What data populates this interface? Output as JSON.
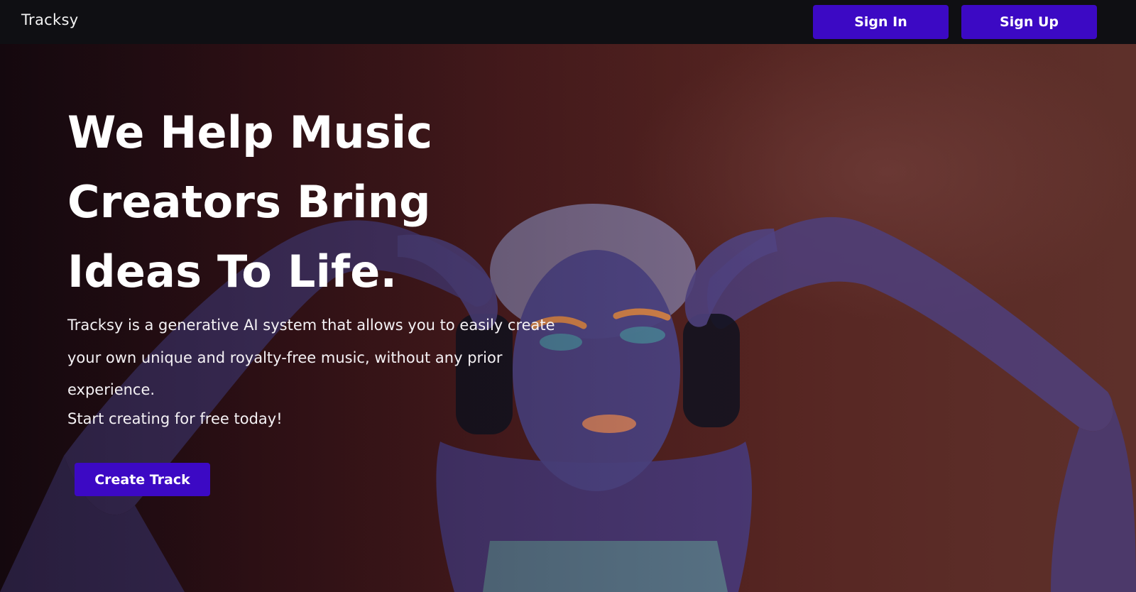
{
  "header": {
    "brand": "Tracksy",
    "sign_in_label": "Sign In",
    "sign_up_label": "Sign Up"
  },
  "hero": {
    "title": "We Help Music Creators Bring Ideas To Life.",
    "description": "Tracksy is a generative AI system that allows you to easily create your own unique and royalty-free music, without any prior experience.",
    "cta_text": "Start creating for free today!",
    "create_button_label": "Create Track",
    "image_icon": "woman-with-headphones-image"
  },
  "colors": {
    "nav_background": "#0f0f13",
    "button_accent": "#3c09c4",
    "hero_tint": "#4d1d1e"
  }
}
